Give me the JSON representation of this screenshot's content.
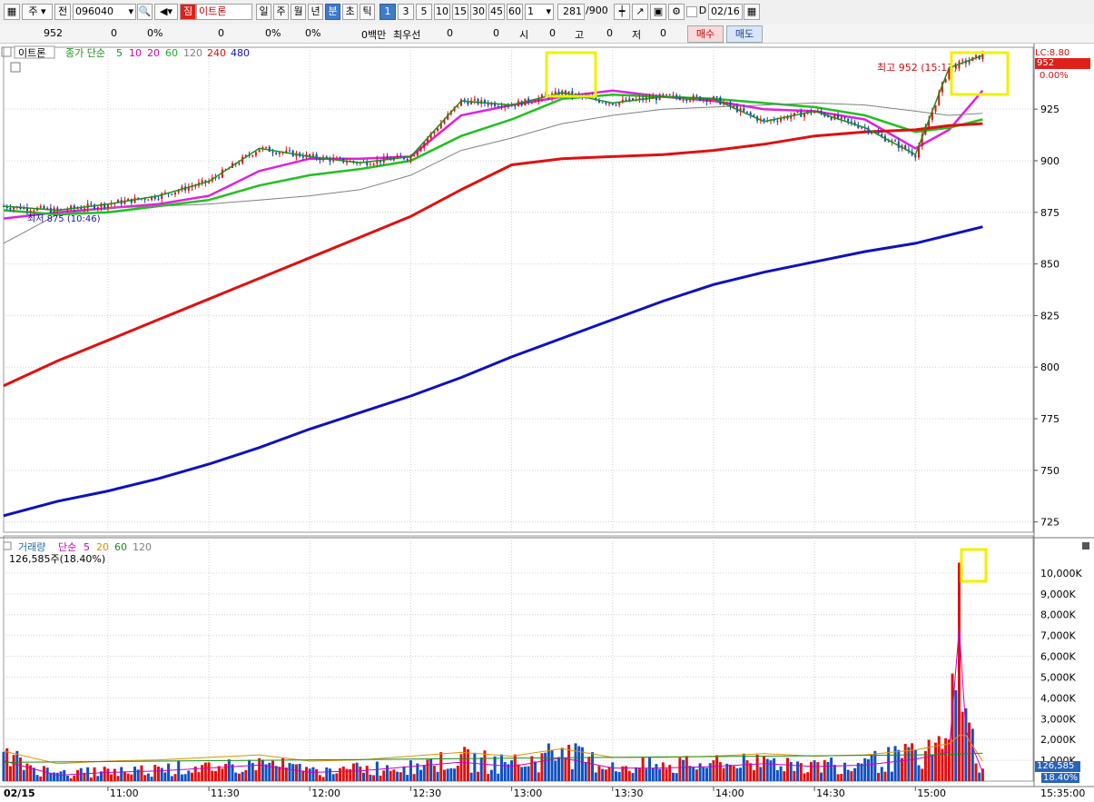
{
  "toolbar": {
    "type_label": "주",
    "prev_label": "전",
    "code": "096040",
    "badge": "짐",
    "name": "이트론",
    "periods": [
      "일",
      "주",
      "월",
      "년",
      "분",
      "초",
      "틱"
    ],
    "active_period": "분",
    "intervals": [
      "1",
      "3",
      "5",
      "10",
      "15",
      "30",
      "45",
      "60"
    ],
    "active_interval": "1",
    "multiplier": "1",
    "count": "281",
    "count_max": "/900",
    "d_label": "D",
    "date": "02/16"
  },
  "quote": {
    "price": "952",
    "change": "0",
    "change_pct": "0%",
    "volume": "0",
    "vol_pct": "0%",
    "vol_pct2": "0%",
    "amount": "0백만",
    "best_label": "최우선",
    "best_bid": "0",
    "best_ask": "0",
    "open_label": "시",
    "open": "0",
    "high_label": "고",
    "high": "0",
    "low_label": "저",
    "low": "0",
    "buy_label": "매수",
    "sell_label": "매도"
  },
  "price_panel": {
    "title": "이트론",
    "ma_label": "종가 단순",
    "ma_periods": [
      {
        "p": "5",
        "color": "#1a8f1a"
      },
      {
        "p": "10",
        "color": "#c800c8"
      },
      {
        "p": "20",
        "color": "#c800c8"
      },
      {
        "p": "60",
        "color": "#1faa1f"
      },
      {
        "p": "120",
        "color": "#808080"
      },
      {
        "p": "240",
        "color": "#e01010"
      },
      {
        "p": "480",
        "color": "#1010c0"
      }
    ],
    "high_annotation": "최고 952 (15:13)",
    "low_annotation": "최저 875 (10:46)",
    "lc_label": "LC:8.80",
    "price_label": "952",
    "pct_label": "0.00%",
    "y_ticks": [
      "925",
      "900",
      "875",
      "850",
      "825",
      "800",
      "775",
      "750",
      "725"
    ]
  },
  "volume_panel": {
    "title": "거래량",
    "ma_label": "단순",
    "ma_periods": [
      {
        "p": "5",
        "color": "#c800c8"
      },
      {
        "p": "20",
        "color": "#e09000"
      },
      {
        "p": "60",
        "color": "#1a8f1a"
      },
      {
        "p": "120",
        "color": "#808080"
      }
    ],
    "current": "126,585주(18.40%)",
    "vol_label": "126,585",
    "vol_pct": "18.40%",
    "y_ticks": [
      "10,000K",
      "9,000K",
      "8,000K",
      "7,000K",
      "6,000K",
      "5,000K",
      "4,000K",
      "3,000K",
      "2,000K",
      "1,000K"
    ]
  },
  "x_axis": {
    "date_label": "02/15",
    "ticks": [
      "11:00",
      "11:30",
      "12:00",
      "12:30",
      "13:00",
      "13:30",
      "14:00",
      "14:30",
      "15:00"
    ],
    "right_label": "15:35:00"
  },
  "chart_data": {
    "type": "line",
    "x": [
      "10:29",
      "10:45",
      "11:00",
      "11:15",
      "11:30",
      "11:45",
      "12:00",
      "12:15",
      "12:30",
      "12:45",
      "13:00",
      "13:15",
      "13:30",
      "13:45",
      "14:00",
      "14:15",
      "14:30",
      "14:45",
      "15:00",
      "15:10",
      "15:20"
    ],
    "series": [
      {
        "name": "종가",
        "color": "#1a8f1a",
        "values": [
          878,
          876,
          879,
          883,
          890,
          906,
          902,
          899,
          902,
          929,
          927,
          933,
          928,
          931,
          930,
          919,
          924,
          916,
          903,
          945,
          951
        ]
      },
      {
        "name": "20",
        "color": "#e020e0",
        "values": [
          872,
          875,
          877,
          879,
          883,
          895,
          901,
          901,
          902,
          922,
          927,
          931,
          934,
          931,
          929,
          925,
          924,
          920,
          906,
          915,
          934
        ]
      },
      {
        "name": "60",
        "color": "#20c020",
        "values": [
          876,
          874,
          875,
          878,
          881,
          888,
          893,
          896,
          900,
          912,
          920,
          930,
          932,
          931,
          930,
          928,
          926,
          922,
          914,
          916,
          920
        ]
      },
      {
        "name": "120",
        "color": "#808080",
        "values": [
          860,
          874,
          877,
          878,
          879,
          881,
          883,
          886,
          893,
          905,
          911,
          918,
          922,
          925,
          926,
          927,
          928,
          927,
          924,
          922,
          923
        ]
      },
      {
        "name": "240",
        "color": "#e01010",
        "values": [
          791,
          803,
          813,
          823,
          833,
          843,
          853,
          863,
          873,
          886,
          898,
          901,
          902,
          903,
          905,
          908,
          912,
          914,
          915,
          917,
          918
        ]
      },
      {
        "name": "480",
        "color": "#1010c0",
        "values": [
          728,
          735,
          740,
          746,
          753,
          761,
          770,
          778,
          786,
          795,
          805,
          814,
          823,
          832,
          840,
          846,
          851,
          856,
          860,
          864,
          868
        ]
      }
    ],
    "volume": {
      "x": [
        "10:29",
        "10:45",
        "11:00",
        "11:15",
        "11:30",
        "11:45",
        "12:00",
        "12:15",
        "12:30",
        "12:45",
        "13:00",
        "13:15",
        "13:30",
        "13:45",
        "14:00",
        "14:15",
        "14:30",
        "14:45",
        "15:00",
        "15:10",
        "15:13",
        "15:15",
        "15:20"
      ],
      "values": [
        1400,
        400,
        600,
        700,
        900,
        1100,
        600,
        700,
        1000,
        1300,
        1000,
        1600,
        900,
        900,
        1000,
        1200,
        1000,
        1100,
        1500,
        2000,
        10500,
        3500,
        600
      ]
    },
    "ylim": [
      720,
      955
    ],
    "volume_ylim": [
      0,
      11000
    ]
  }
}
